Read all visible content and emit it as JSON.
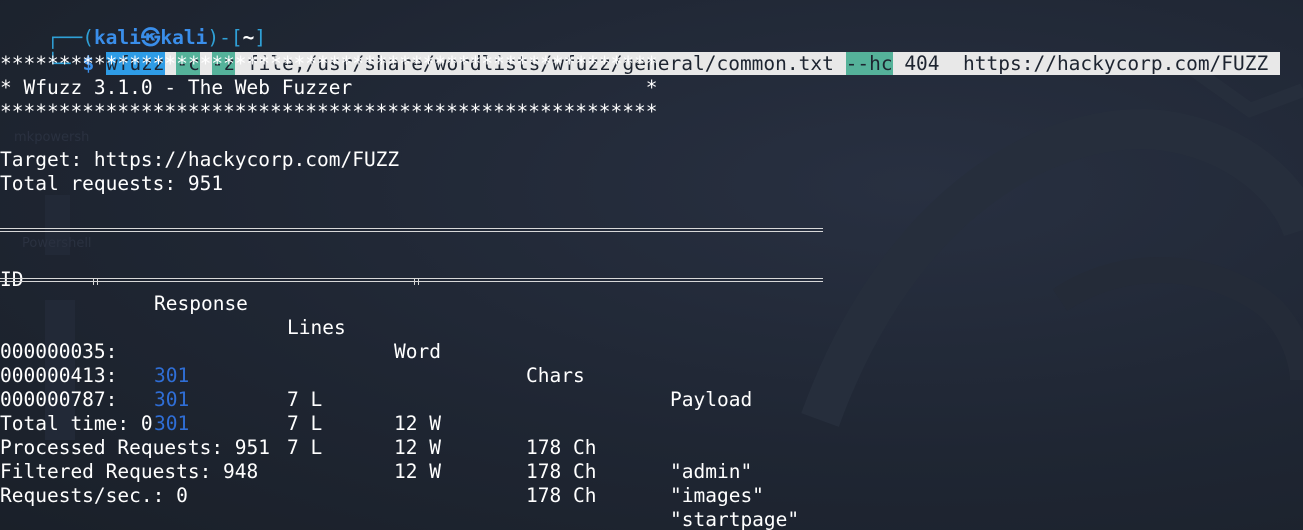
{
  "prompt": {
    "corner_top": "┌──(",
    "user": "kali",
    "at_symbol": "㉿",
    "host": "kali",
    "dir_open": ")-[",
    "dir": "~",
    "dir_close": "]",
    "corner_bottom": "└─",
    "dollar": "$"
  },
  "command": {
    "program": "wfuzz",
    "gap1": " ",
    "flag_c": "-c",
    "gap2": " ",
    "flag_z": "-z",
    "payload_arg": " file,/usr/share/wordlists/wfuzz/general/common.txt ",
    "flag_hc": "--hc",
    "rest": " 404  https://hackycorp.com/FUZZ "
  },
  "banner": {
    "stars": "********************************************************",
    "title_line": "* Wfuzz 3.1.0 - The Web Fuzzer                         *"
  },
  "target_line": "Target: https://hackycorp.com/FUZZ",
  "total_requests_line": "Total requests: 951",
  "table": {
    "headers": [
      "ID",
      "Response",
      "Lines",
      "Word",
      "Chars",
      "Payload"
    ],
    "rows": [
      {
        "id": "000000035:",
        "response": "301",
        "lines": "7 L",
        "word": "12 W",
        "chars": "178 Ch",
        "payload": "\"admin\""
      },
      {
        "id": "000000413:",
        "response": "301",
        "lines": "7 L",
        "word": "12 W",
        "chars": "178 Ch",
        "payload": "\"images\""
      },
      {
        "id": "000000787:",
        "response": "301",
        "lines": "7 L",
        "word": "12 W",
        "chars": "178 Ch",
        "payload": "\"startpage\""
      }
    ]
  },
  "summary": {
    "total_time": "Total time: 0",
    "processed": "Processed Requests: 951",
    "filtered": "Filtered Requests: 948",
    "rate": "Requests/sec.: 0"
  },
  "background": {
    "ghost_label_1": "mkpowersh",
    "ghost_label_2": "Powershell"
  },
  "colors": {
    "background": "#1d2430",
    "prompt_blue": "#3a8eea",
    "selection": "#e8e8e8",
    "selection_program": "#2e9ce6",
    "selection_flag": "#55b29a",
    "status_301": "#2f6ed6"
  }
}
